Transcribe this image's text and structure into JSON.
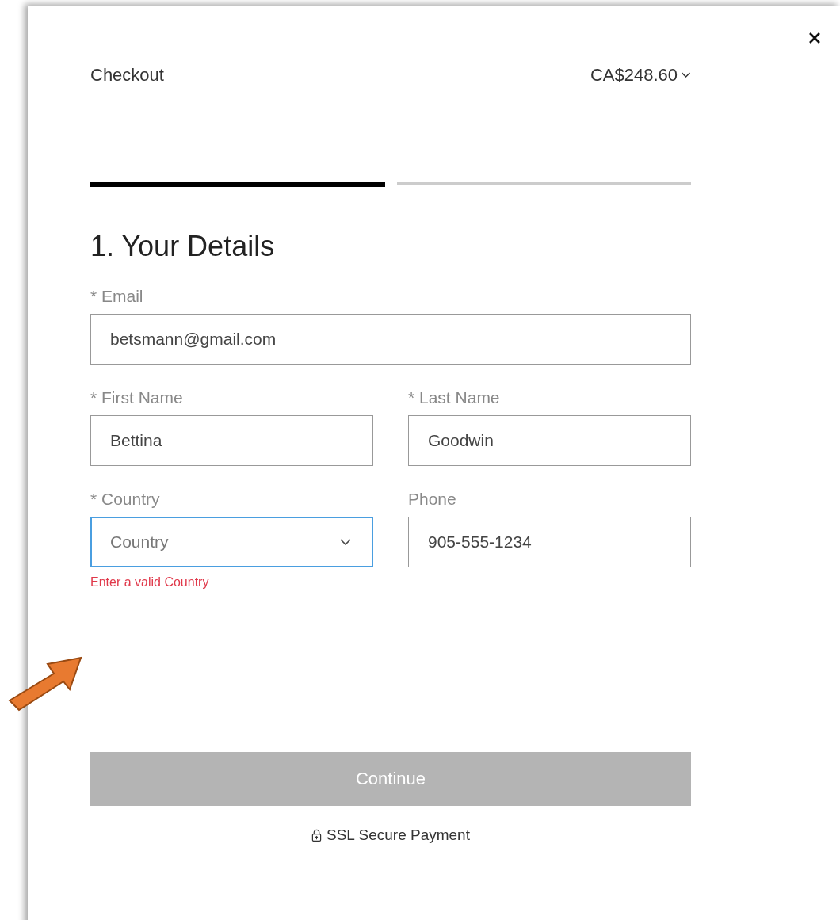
{
  "header": {
    "title": "Checkout",
    "total": "CA$248.60"
  },
  "progress": [
    {
      "done": true
    },
    {
      "done": false
    }
  ],
  "heading": "1. Your Details",
  "rows": [
    [
      {
        "kind": "text",
        "label": "* Email",
        "value": "betsmann@gmail.com",
        "focused": false
      }
    ],
    [
      {
        "kind": "text",
        "label": "* First Name",
        "value": "Bettina",
        "focused": false
      },
      {
        "kind": "text",
        "label": "* Last Name",
        "value": "Goodwin",
        "focused": false
      }
    ],
    [
      {
        "kind": "select",
        "label": "* Country",
        "placeholder": "Country",
        "focused": true,
        "error": "Enter a valid Country"
      },
      {
        "kind": "text",
        "label": "Phone",
        "value": "905-555-1234",
        "focused": false
      }
    ]
  ],
  "continue_button": {
    "label": "Continue",
    "disabled": true
  },
  "secure_note": "SSL Secure Payment"
}
